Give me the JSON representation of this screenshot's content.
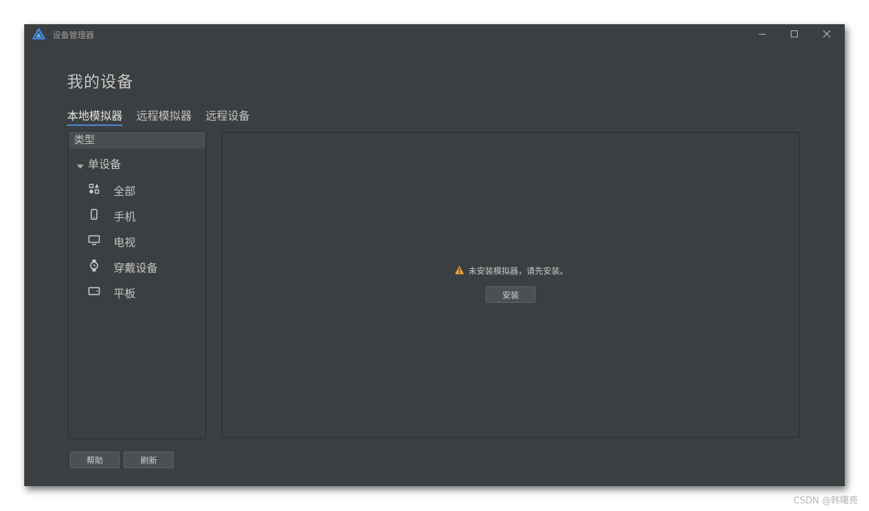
{
  "window": {
    "title": "设备管理器"
  },
  "page": {
    "title": "我的设备"
  },
  "tabs": [
    {
      "label": "本地模拟器",
      "active": true
    },
    {
      "label": "远程模拟器",
      "active": false
    },
    {
      "label": "远程设备",
      "active": false
    }
  ],
  "sidebar": {
    "header": "类型",
    "group_label": "单设备",
    "items": [
      {
        "label": "全部",
        "icon": "grid-icon"
      },
      {
        "label": "手机",
        "icon": "phone-icon"
      },
      {
        "label": "电视",
        "icon": "tv-icon"
      },
      {
        "label": "穿戴设备",
        "icon": "watch-icon"
      },
      {
        "label": "平板",
        "icon": "tablet-icon"
      }
    ]
  },
  "content": {
    "warning_text": "未安装模拟器，请先安装。",
    "install_label": "安装"
  },
  "footer": {
    "help_label": "帮助",
    "refresh_label": "刷新"
  },
  "watermark": "CSDN @韩曙亮",
  "colors": {
    "background": "#3c3f41",
    "accent_underline": "#4a8ad9",
    "warning": "#e8a33c"
  }
}
